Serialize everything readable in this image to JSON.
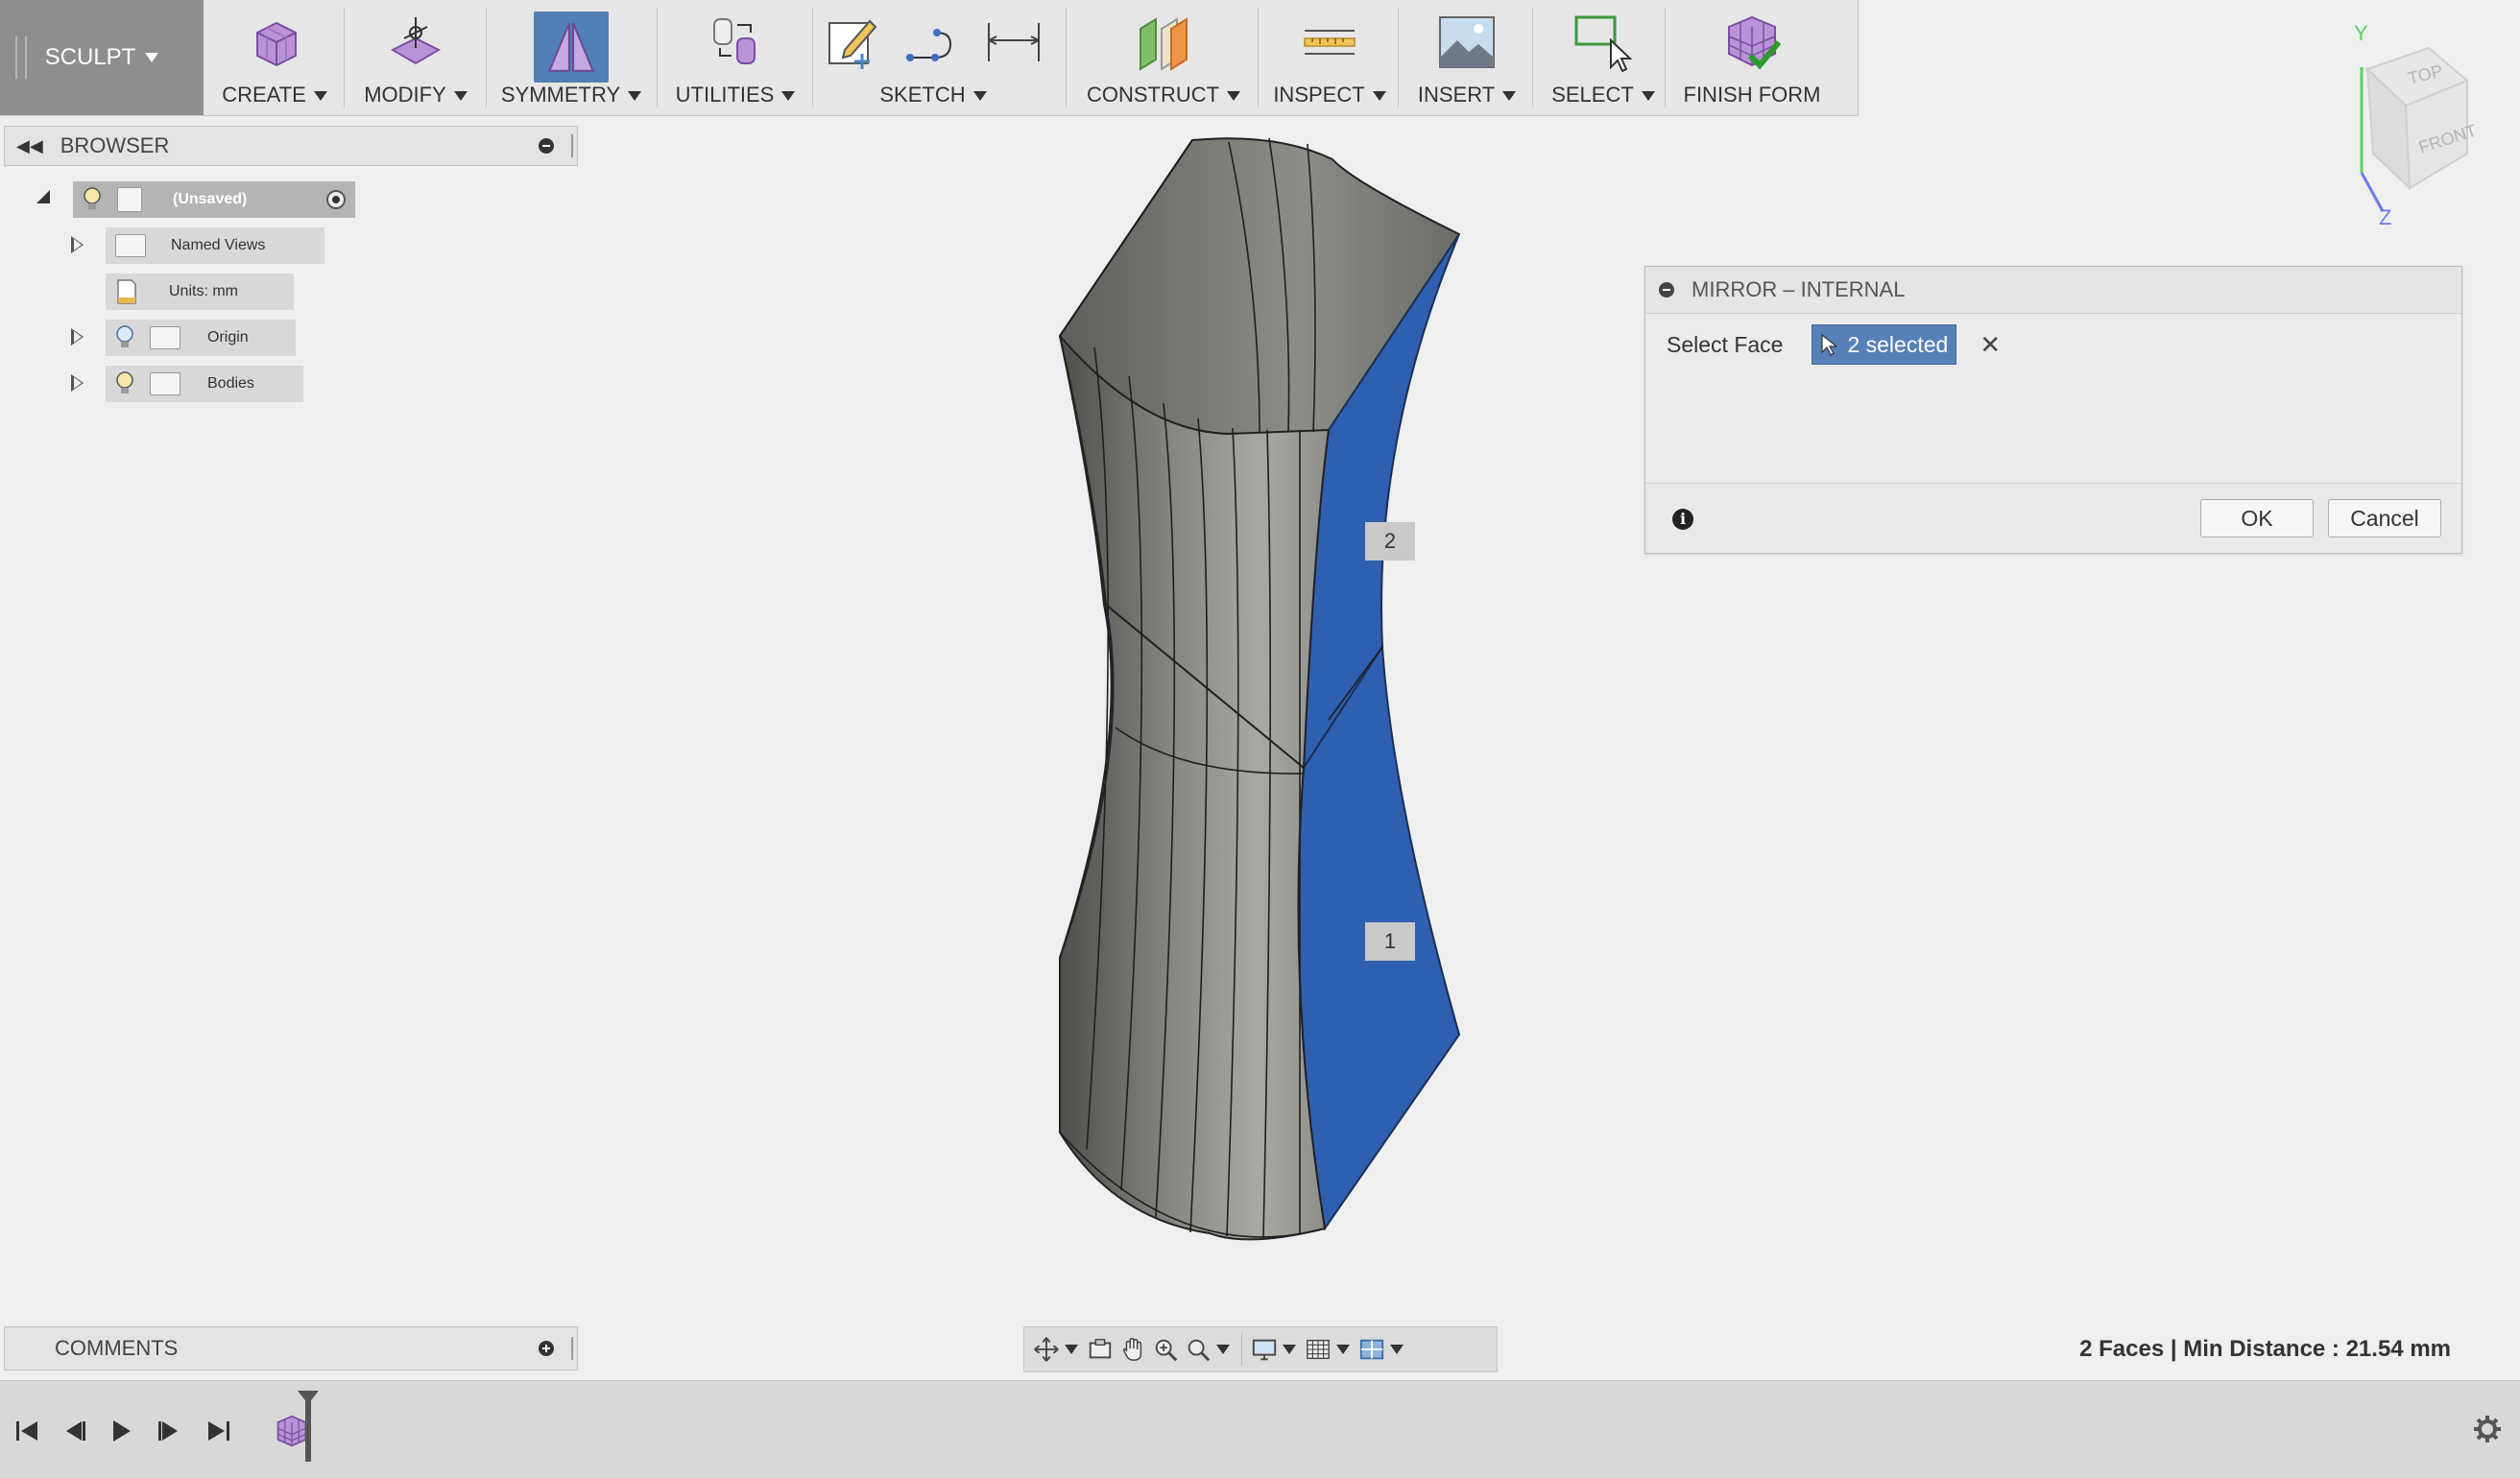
{
  "toolbar": {
    "workspace": "SCULPT",
    "groups": [
      {
        "label": "CREATE"
      },
      {
        "label": "MODIFY"
      },
      {
        "label": "SYMMETRY"
      },
      {
        "label": "UTILITIES"
      },
      {
        "label": "SKETCH"
      },
      {
        "label": "CONSTRUCT"
      },
      {
        "label": "INSPECT"
      },
      {
        "label": "INSERT"
      },
      {
        "label": "SELECT"
      },
      {
        "label": "FINISH FORM"
      }
    ]
  },
  "browser": {
    "title": "BROWSER",
    "root": "(Unsaved)",
    "items": [
      {
        "label": "Named Views"
      },
      {
        "label": "Units: mm"
      },
      {
        "label": "Origin"
      },
      {
        "label": "Bodies"
      }
    ]
  },
  "comments": {
    "title": "COMMENTS"
  },
  "dialog": {
    "title": "MIRROR – INTERNAL",
    "field_label": "Select Face",
    "selection": "2 selected",
    "ok": "OK",
    "cancel": "Cancel"
  },
  "viewport": {
    "face_tags": [
      "2",
      "1"
    ],
    "selected_color": "#2f5fb0",
    "body_color": "#7a7a74"
  },
  "viewcube": {
    "top": "TOP",
    "front": "FRONT",
    "axis_y": "Y",
    "axis_z": "Z"
  },
  "status": "2 Faces | Min Distance : 21.54 mm"
}
